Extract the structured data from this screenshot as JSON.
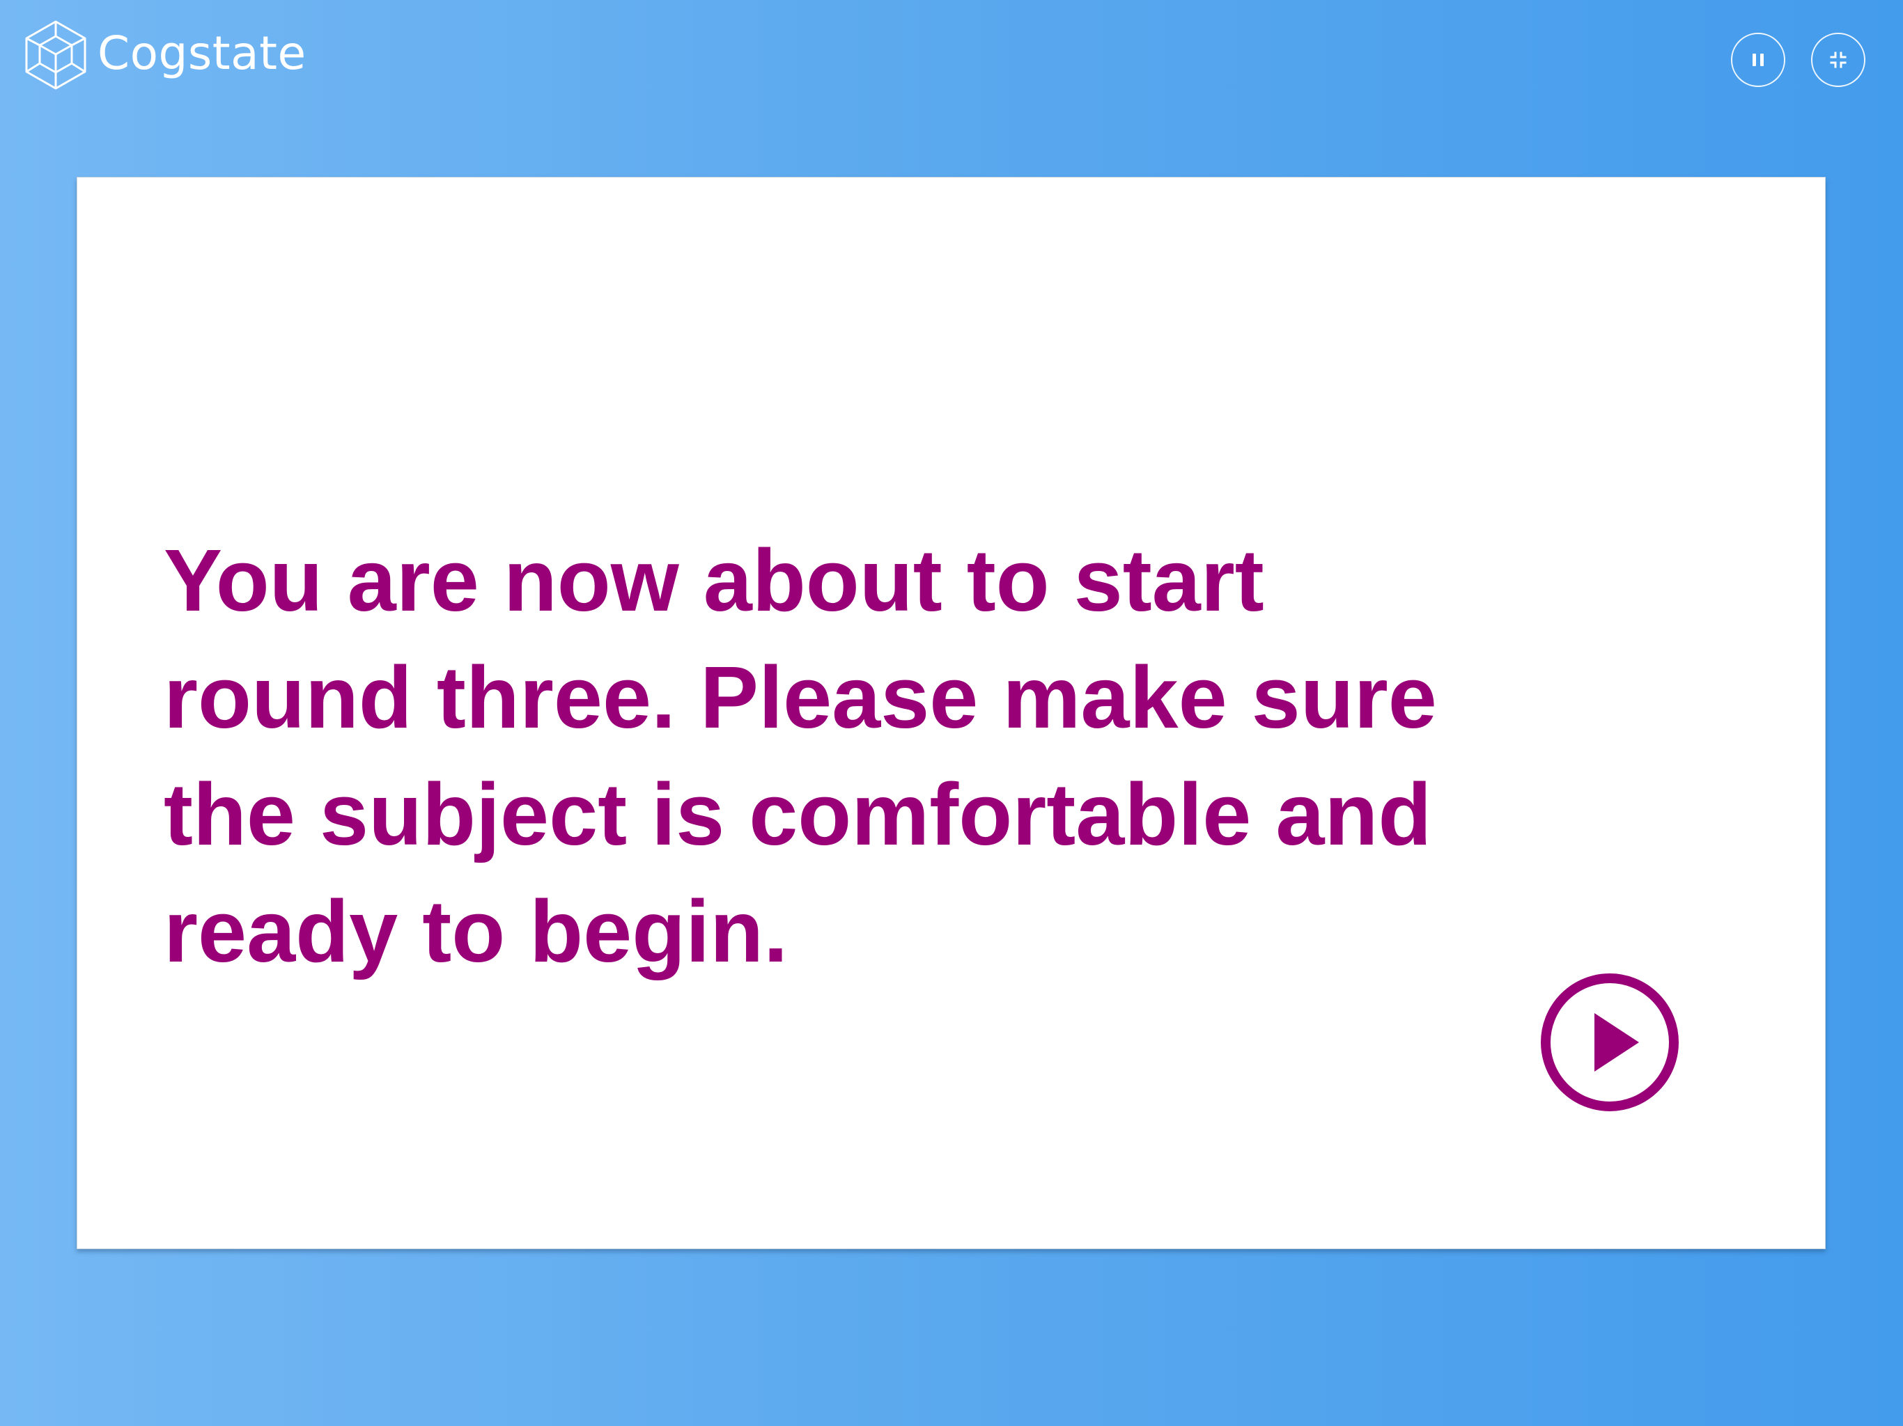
{
  "header": {
    "brand_name": "Cogstate",
    "logo_icon": "cube-icon",
    "controls": [
      {
        "name": "pause-button",
        "icon": "pause-icon"
      },
      {
        "name": "exit-fullscreen-button",
        "icon": "exit-fullscreen-icon"
      }
    ]
  },
  "main": {
    "message": "You are now about to start round three. Please make sure the subject is comfortable and ready to begin.",
    "play_icon": "play-icon"
  },
  "colors": {
    "background_gradient_start": "#75b8f4",
    "background_gradient_end": "#449cec",
    "accent": "#990077",
    "card": "#ffffff",
    "header_foreground": "#ffffff"
  }
}
